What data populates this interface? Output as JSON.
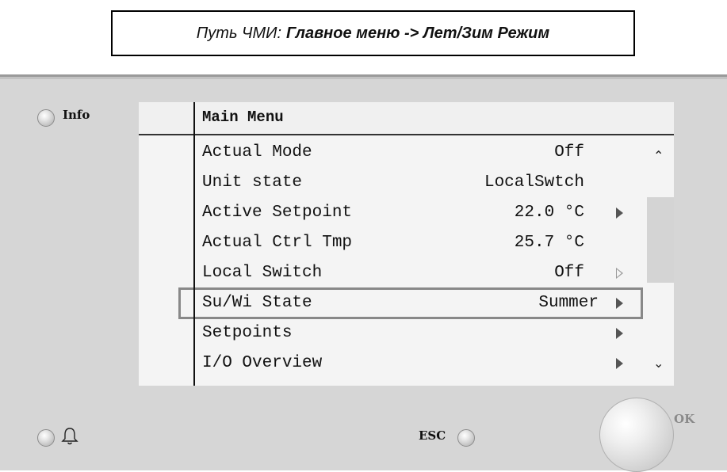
{
  "header": {
    "prefix": "Путь ЧМИ:",
    "route": "Главное меню -> Лет/Зим Режим"
  },
  "panel": {
    "info_label": "Info",
    "esc_label": "ESC",
    "ok_label": "OK",
    "bell_icon": "bell-icon"
  },
  "screen": {
    "title": "Main Menu",
    "rows": [
      {
        "label": "Actual Mode",
        "value": "Off",
        "arrow": "none"
      },
      {
        "label": "Unit state",
        "value": "LocalSwtch",
        "arrow": "none"
      },
      {
        "label": "Active Setpoint",
        "value": "22.0 °C",
        "arrow": "filled"
      },
      {
        "label": "Actual Ctrl Tmp",
        "value": "25.7 °C",
        "arrow": "none"
      },
      {
        "label": "Local Switch",
        "value": "Off",
        "arrow": "outline"
      },
      {
        "label": "Su/Wi State",
        "value": "Summer",
        "arrow": "filled"
      },
      {
        "label": "Setpoints",
        "value": "",
        "arrow": "filled"
      },
      {
        "label": "I/O Overview",
        "value": "",
        "arrow": "filled"
      }
    ],
    "selected_index": 5,
    "scroll_up_icon": "chevron-up-icon",
    "scroll_down_icon": "chevron-down-icon"
  }
}
